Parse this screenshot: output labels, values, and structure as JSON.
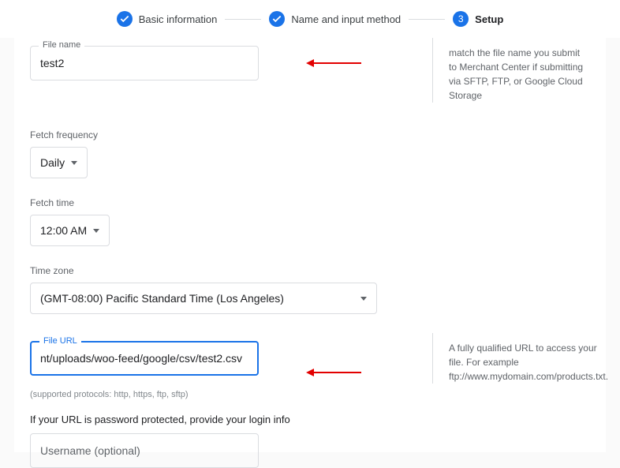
{
  "stepper": {
    "steps": [
      {
        "label": "Basic information"
      },
      {
        "label": "Name and input method"
      },
      {
        "number": "3",
        "label": "Setup"
      }
    ]
  },
  "file_name": {
    "label": "File name",
    "value": "test2",
    "help": "match the file name you submit to Merchant Center if submitting via SFTP, FTP, or Google Cloud Storage"
  },
  "fetch_frequency": {
    "label": "Fetch frequency",
    "value": "Daily"
  },
  "fetch_time": {
    "label": "Fetch time",
    "value": "12:00 AM"
  },
  "time_zone": {
    "label": "Time zone",
    "value": "(GMT-08:00) Pacific Standard Time (Los Angeles)"
  },
  "file_url": {
    "label": "File URL",
    "value": "nt/uploads/woo-feed/google/csv/test2.csv",
    "help": "A fully qualified URL to access your file. For example ftp://www.mydomain.com/products.txt.",
    "hint": "(supported protocols: http, https, ftp, sftp)"
  },
  "auth": {
    "prompt": "If your URL is password protected, provide your login info",
    "username_placeholder": "Username (optional)"
  }
}
